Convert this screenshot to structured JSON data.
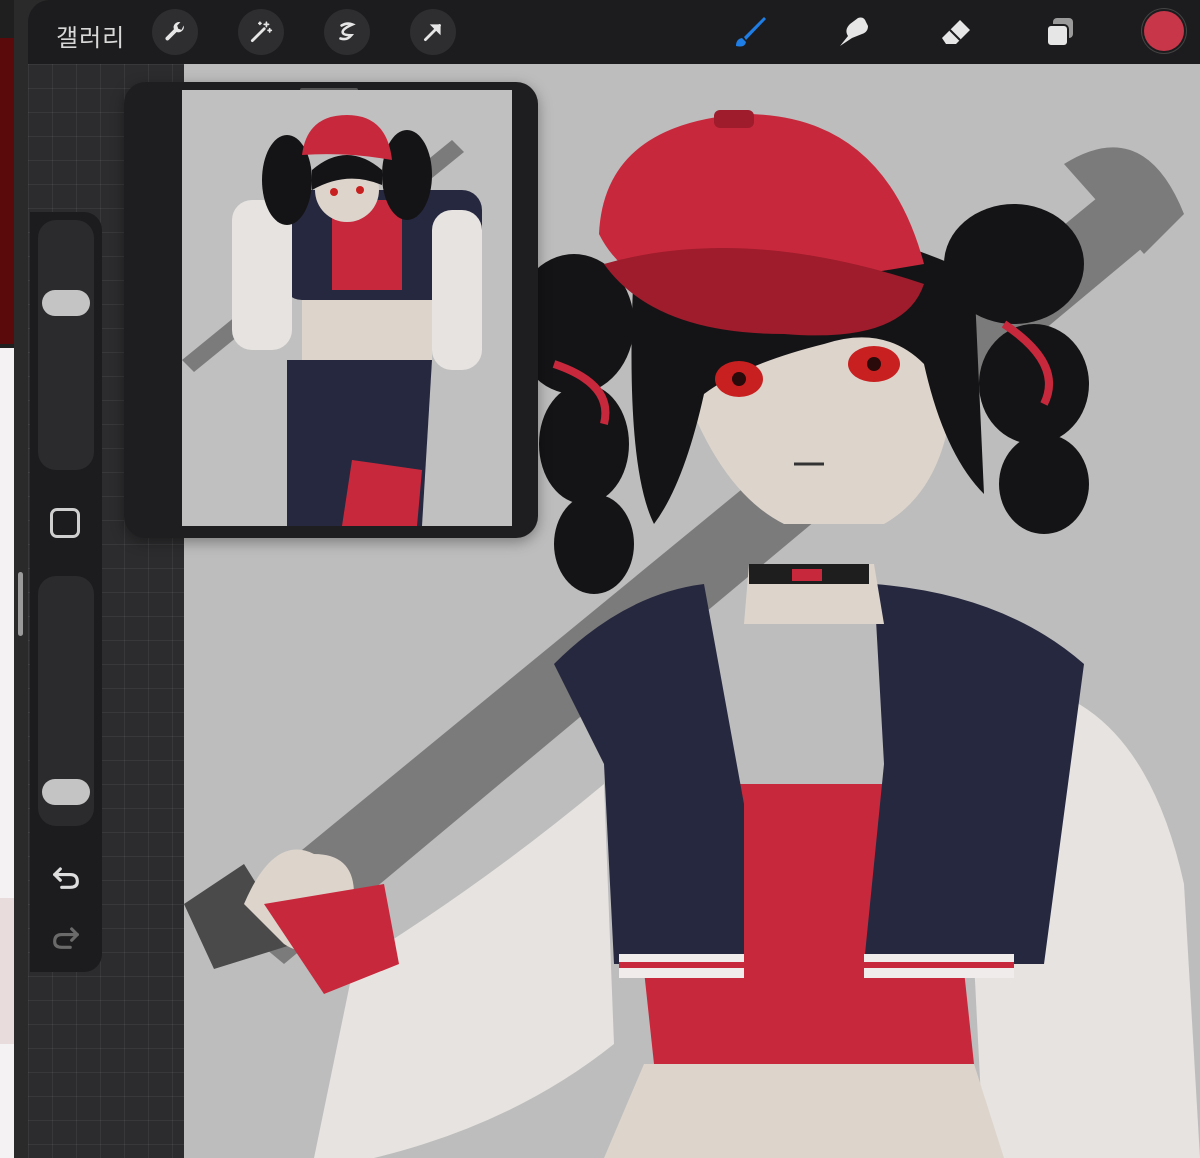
{
  "toolbar": {
    "gallery_label": "갤러리",
    "left_tools": [
      "wrench-icon",
      "magic-wand-icon",
      "selection-s-icon",
      "transform-arrow-icon"
    ],
    "right_tools": [
      "brush-icon",
      "smudge-icon",
      "eraser-icon",
      "layers-icon"
    ],
    "active_tool": "brush-icon",
    "current_color": "#c8364a",
    "active_color": "#1e7ee6"
  },
  "sidebar": {
    "size_slider_level": 0.7,
    "opacity_slider_level": 0.07,
    "icons": [
      "modify-square-icon",
      "undo-icon",
      "redo-icon"
    ]
  },
  "colors": {
    "cap_red": "#c8283c",
    "jacket_navy": "#26283f",
    "sleeve_white": "#e6e3e0",
    "skin": "#ddd4cc",
    "hair_black": "#141416",
    "bat_gray": "#7b7b7b"
  }
}
